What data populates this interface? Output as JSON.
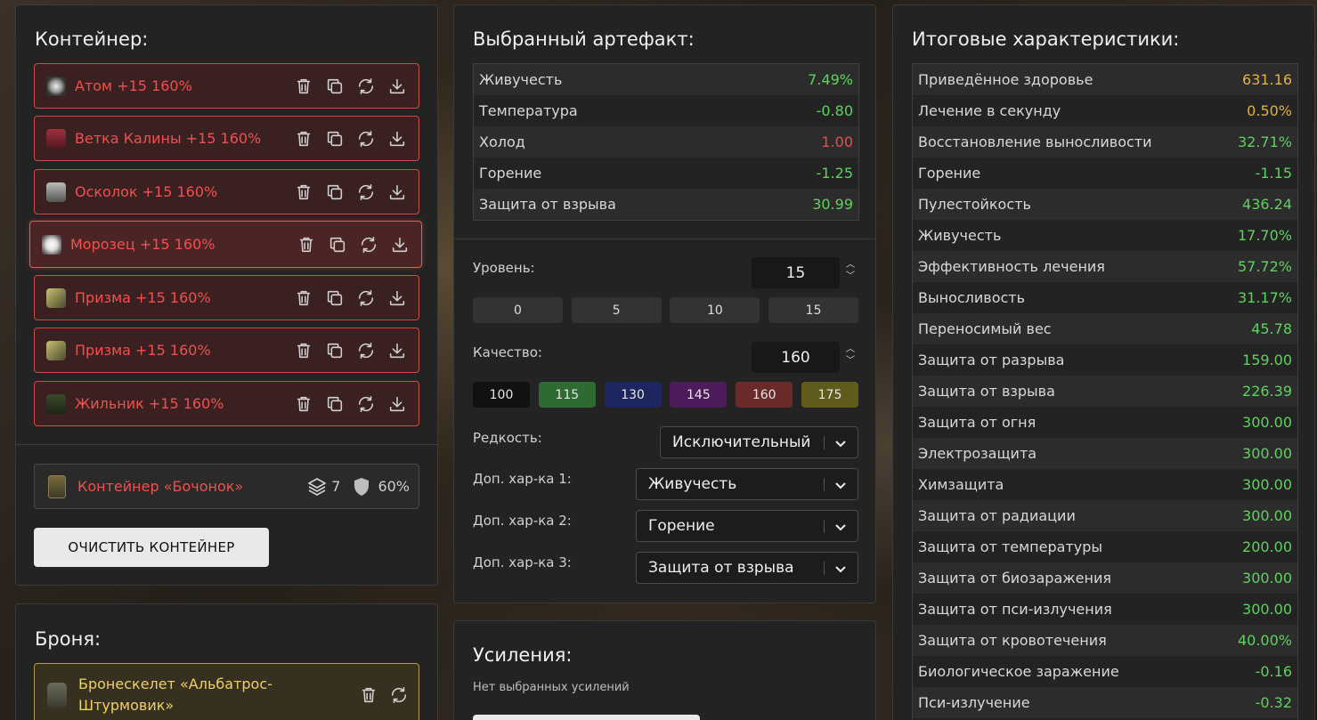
{
  "container": {
    "title": "Контейнер:",
    "items": [
      {
        "name": "Атом +15 160%",
        "icon": "atom-artifact-icon"
      },
      {
        "name": "Ветка Калины +15 160%",
        "icon": "kalina-branch-artifact-icon"
      },
      {
        "name": "Осколок +15 160%",
        "icon": "shard-artifact-icon"
      },
      {
        "name": "Морозец +15 160%",
        "icon": "frost-artifact-icon"
      },
      {
        "name": "Призма +15 160%",
        "icon": "prism-artifact-icon"
      },
      {
        "name": "Призма +15 160%",
        "icon": "prism-artifact-icon"
      },
      {
        "name": "Жильник +15 160%",
        "icon": "vein-artifact-icon"
      }
    ],
    "box": {
      "name": "Контейнер «Бочонок»",
      "slots": "7",
      "protection": "60%"
    },
    "clear_label": "ОЧИСТИТЬ КОНТЕЙНЕР"
  },
  "armor": {
    "title": "Броня:",
    "item_line1": "Бронескелет «Альбатрос-",
    "item_line2": "Штурмовик»"
  },
  "selected": {
    "title": "Выбранный артефакт:",
    "stats": [
      {
        "label": "Живучесть",
        "value": "7.49%",
        "color": "#5dd35d"
      },
      {
        "label": "Температура",
        "value": "-0.80",
        "color": "#5dd35d"
      },
      {
        "label": "Холод",
        "value": "1.00",
        "color": "#e05050"
      },
      {
        "label": "Горение",
        "value": "-1.25",
        "color": "#5dd35d"
      },
      {
        "label": "Защита от взрыва",
        "value": "30.99",
        "color": "#5dd35d"
      }
    ],
    "level_label": "Уровень:",
    "level_value": "15",
    "level_presets": [
      "0",
      "5",
      "10",
      "15"
    ],
    "quality_label": "Качество:",
    "quality_value": "160",
    "quality_presets": [
      {
        "v": "100",
        "bg": "#111111"
      },
      {
        "v": "115",
        "bg": "#2e6a32"
      },
      {
        "v": "130",
        "bg": "#1e2660"
      },
      {
        "v": "145",
        "bg": "#4c1c5a"
      },
      {
        "v": "160",
        "bg": "#6a2a2a"
      },
      {
        "v": "175",
        "bg": "#5f5b1c"
      }
    ],
    "rarity_label": "Редкость:",
    "rarity_value": "Исключительный",
    "extra1_label": "Доп. хар-ка 1:",
    "extra1_value": "Живучесть",
    "extra2_label": "Доп. хар-ка 2:",
    "extra2_value": "Горение",
    "extra3_label": "Доп. хар-ка 3:",
    "extra3_value": "Защита от взрыва"
  },
  "boosts": {
    "title": "Усиления:",
    "empty": "Нет выбранных усилений"
  },
  "totals": {
    "title": "Итоговые характеристики:",
    "stats": [
      {
        "label": "Приведённое здоровье",
        "value": "631.16",
        "color": "#e3b23c"
      },
      {
        "label": "Лечение в секунду",
        "value": "0.50%",
        "color": "#e3b23c"
      },
      {
        "label": "Восстановление выносливости",
        "value": "32.71%",
        "color": "#5dd35d"
      },
      {
        "label": "Горение",
        "value": "-1.15",
        "color": "#5dd35d"
      },
      {
        "label": "Пулестойкость",
        "value": "436.24",
        "color": "#5dd35d"
      },
      {
        "label": "Живучесть",
        "value": "17.70%",
        "color": "#5dd35d"
      },
      {
        "label": "Эффективность лечения",
        "value": "57.72%",
        "color": "#5dd35d"
      },
      {
        "label": "Выносливость",
        "value": "31.17%",
        "color": "#5dd35d"
      },
      {
        "label": "Переносимый вес",
        "value": "45.78",
        "color": "#5dd35d"
      },
      {
        "label": "Защита от разрыва",
        "value": "159.00",
        "color": "#5dd35d"
      },
      {
        "label": "Защита от взрыва",
        "value": "226.39",
        "color": "#5dd35d"
      },
      {
        "label": "Защита от огня",
        "value": "300.00",
        "color": "#5dd35d"
      },
      {
        "label": "Электрозащита",
        "value": "300.00",
        "color": "#5dd35d"
      },
      {
        "label": "Химзащита",
        "value": "300.00",
        "color": "#5dd35d"
      },
      {
        "label": "Защита от радиации",
        "value": "300.00",
        "color": "#5dd35d"
      },
      {
        "label": "Защита от температуры",
        "value": "200.00",
        "color": "#5dd35d"
      },
      {
        "label": "Защита от биозаражения",
        "value": "300.00",
        "color": "#5dd35d"
      },
      {
        "label": "Защита от пси-излучения",
        "value": "300.00",
        "color": "#5dd35d"
      },
      {
        "label": "Защита от кровотечения",
        "value": "40.00%",
        "color": "#5dd35d"
      },
      {
        "label": "Биологическое заражение",
        "value": "-0.16",
        "color": "#5dd35d"
      },
      {
        "label": "Пси-излучение",
        "value": "-0.32",
        "color": "#5dd35d"
      }
    ]
  }
}
